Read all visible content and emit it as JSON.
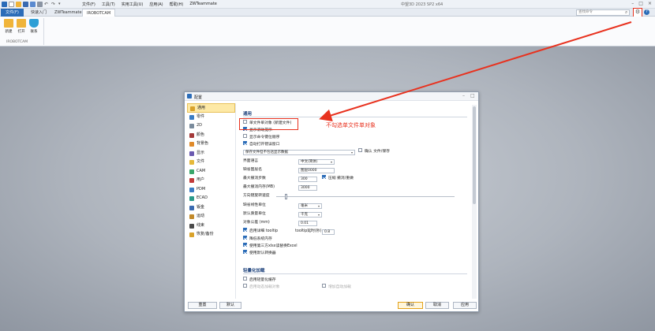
{
  "window": {
    "title": "中望3D 2023 SP2 x64",
    "quick_icons": [
      "app-logo-icon",
      "new-icon",
      "open-icon",
      "save-icon",
      "saveas-icon",
      "print-icon",
      "undo-icon",
      "redo-icon",
      "dropdown-icon"
    ],
    "menus": [
      "文件(F)",
      "工具(T)",
      "实用工具(U)",
      "应用(A)",
      "帮助(H)",
      "ZWTeammate"
    ],
    "controls": [
      "–",
      "□",
      "×"
    ]
  },
  "tabs": [
    "文件(F)",
    "快速入门",
    "ZWTeammate",
    "IROBOTCAM"
  ],
  "search": {
    "placeholder": "查找命令"
  },
  "ribbon": {
    "buttons": [
      {
        "label": "新建",
        "icon": "folder-new-icon",
        "color": "#f0b43a"
      },
      {
        "label": "打开",
        "icon": "folder-open-icon",
        "color": "#f0b43a"
      },
      {
        "label": "联系",
        "icon": "shield-icon",
        "color": "#2e9fd6"
      }
    ],
    "group_label": "IROBOTCAM"
  },
  "dialog": {
    "title": "配置",
    "controls": [
      "–",
      "□"
    ],
    "sidebar": [
      {
        "label": "通用",
        "icon": "settings-icon",
        "color": "#d9a22b",
        "active": true
      },
      {
        "label": "零件",
        "icon": "part-icon",
        "color": "#3a7cc4"
      },
      {
        "label": "2D",
        "icon": "2d-icon",
        "color": "#7a8b9c"
      },
      {
        "label": "颜色",
        "icon": "color-icon",
        "color": "#a43a3a"
      },
      {
        "label": "背景色",
        "icon": "background-icon",
        "color": "#e08a2a"
      },
      {
        "label": "显示",
        "icon": "display-icon",
        "color": "#6b5ab0"
      },
      {
        "label": "文件",
        "icon": "file-icon",
        "color": "#e6b93a"
      },
      {
        "label": "CAM",
        "icon": "cam-icon",
        "color": "#3aa66a"
      },
      {
        "label": "用户",
        "icon": "user-icon",
        "color": "#c23a3a"
      },
      {
        "label": "PDM",
        "icon": "pdm-icon",
        "color": "#3a7cc4"
      },
      {
        "label": "ECAD",
        "icon": "ecad-icon",
        "color": "#2a9a8a"
      },
      {
        "label": "钣金",
        "icon": "sheetmetal-icon",
        "color": "#3a6ab0"
      },
      {
        "label": "运动",
        "icon": "motion-icon",
        "color": "#c28a2a"
      },
      {
        "label": "线束",
        "icon": "harness-icon",
        "color": "#4a4a4a"
      },
      {
        "label": "恢复/备份",
        "icon": "backup-icon",
        "color": "#d9a22b"
      }
    ],
    "section_general": "通用",
    "checkbox_single_file": "单文件单对象 (新建文件)",
    "checkbox_show_hints": "显示滚动提示",
    "checkbox_show_cmd_order": "显示命令键位顺序",
    "checkbox_auto_open_log": "自动打开错误窗口",
    "save_option_value": "保存文件但不包括显示数据",
    "confirm_save_label": "确认 文件/保存",
    "ui_language_label": "界面语言",
    "ui_language_value": "中文(简体)",
    "default_layer_label": "缺省图层名",
    "default_layer_value": "图层0000",
    "max_undo_label": "最大撤消步数",
    "max_undo_value": "300",
    "compress_label": "压缩 撤消/重做",
    "max_memory_label": "最大撤消内存(MB)",
    "max_memory_value": "3000",
    "wheel_speed_label": "方向键旋转速度",
    "wheel_speed_value": 0.05,
    "default_unit_label": "缺省线性单位",
    "default_unit_value": "毫米",
    "default_mass_label": "默认质量单位",
    "default_mass_value": "千克",
    "tolerance_label": "对象公差 (mm)",
    "tolerance_value": "0.01",
    "tooltip_label": "启用详细 tooltip",
    "tooltip_delay_label": "tooltip延时(秒)",
    "tooltip_delay_value": "0.8",
    "checkbox_reduce_memory": "降低系统内存",
    "checkbox_third_party_excel": "使用第三方xlsx读替换Excel",
    "checkbox_default_converter": "使用默认转换器",
    "section_light": "轻量化加载",
    "checkbox_enable_light": "启用轻量化缓存",
    "faded_left": "启用动态加载对象",
    "faded_right": "增加自动加载",
    "buttons": {
      "reset": "重置",
      "default": "默认",
      "ok": "确认",
      "cancel": "取消",
      "apply": "应用"
    }
  },
  "annotation": {
    "note": "不勾选单文件单对象",
    "color": "#e8321f"
  }
}
